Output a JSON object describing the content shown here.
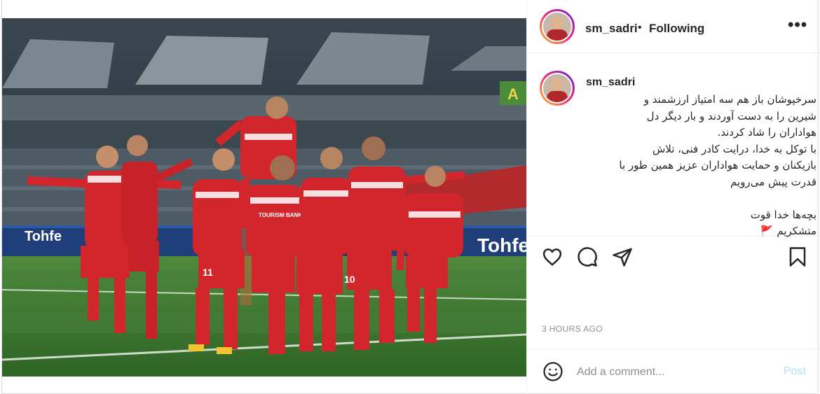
{
  "header": {
    "username": "sm_sadri",
    "separator": "•",
    "follow_status": "Following",
    "more_icon": "more-horizontal-icon",
    "more_label": "•••"
  },
  "caption": {
    "username": "sm_sadri",
    "text": "سرخپوشان باز هم سه امتیاز ارزشمند و\nشیرین را به دست آوردند و بار دیگر دل\nهواداران را شاد کردند.\nبا توکل به خدا، درایت کادر فنی، تلاش\nبازیکنان و حمایت هواداران عزیز همین طور با\nقدرت پیش می‌رویم\n\nبچه‌ها خدا قوت\nمتشکریم 🚩"
  },
  "photo": {
    "ad_board_left": "Tohfe",
    "ad_board_right": "Tohfe",
    "scoreboard_letter": "A",
    "shirt_sponsor": "TOURISM BANK",
    "numbers": [
      "11",
      "10"
    ]
  },
  "actions": {
    "like_icon": "heart-icon",
    "comment_icon": "comment-icon",
    "share_icon": "send-icon",
    "save_icon": "bookmark-icon"
  },
  "timestamp": "3 HOURS AGO",
  "add_comment": {
    "emoji_icon": "smiley-icon",
    "placeholder": "Add a comment...",
    "post_label": "Post"
  },
  "colors": {
    "jersey_red": "#d2262c",
    "pitch_green": "#3f7a32",
    "post_button": "#b2dffc",
    "muted_text": "#8e8e8e"
  }
}
